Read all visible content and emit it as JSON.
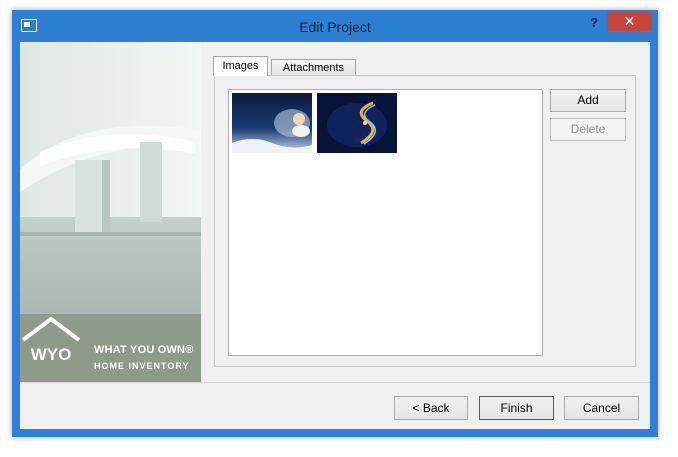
{
  "window": {
    "title": "Edit Project",
    "help_label": "?",
    "close_label": "✕"
  },
  "brand": {
    "logo_text": "WYO",
    "name": "WHAT YOU OWN®",
    "subtitle": "HOME INVENTORY"
  },
  "tabs": [
    {
      "label": "Images",
      "active": true
    },
    {
      "label": "Attachments",
      "active": false
    }
  ],
  "images_panel": {
    "add_label": "Add",
    "delete_label": "Delete"
  },
  "footer": {
    "back_label": "< Back",
    "finish_label": "Finish",
    "cancel_label": "Cancel"
  }
}
